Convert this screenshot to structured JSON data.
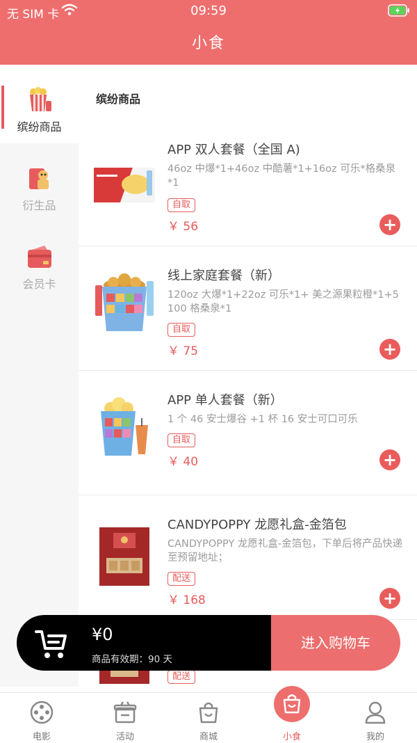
{
  "status_bar": {
    "carrier": "无 SIM 卡",
    "time": "09:59"
  },
  "header": {
    "title": "小食"
  },
  "sidebar": {
    "items": [
      {
        "label": "缤纷商品",
        "icon": "popcorn-icon",
        "active": true
      },
      {
        "label": "衍生品",
        "icon": "merch-icon",
        "active": false
      },
      {
        "label": "会员卡",
        "icon": "card-icon",
        "active": false
      }
    ]
  },
  "main": {
    "section_title": "缤纷商品",
    "products": [
      {
        "name": "APP 双人套餐（全国 A)",
        "desc": "46oz 中爆*1+46oz 中酷薯*1+16oz 可乐*格桑泉*1",
        "badge": "自取",
        "price": "￥ 56"
      },
      {
        "name": "线上家庭套餐（新）",
        "desc": "120oz 大爆*1+22oz 可乐*1+ 美之源果粒橙*1+5 100 格桑泉*1",
        "badge": "自取",
        "price": "￥ 75"
      },
      {
        "name": "APP 单人套餐（新）",
        "desc": "1 个 46 安士爆谷 +1 杯 16 安士可口可乐",
        "badge": "自取",
        "price": "￥ 40"
      },
      {
        "name": "CANDYPOPPY 龙愿礼盒-金箔包",
        "desc": "CANDYPOPPY 龙愿礼盒-金箔包，下单后将产品快递至预留地址；",
        "badge": "配送",
        "price": "￥ 168"
      },
      {
        "badge": "配送"
      }
    ]
  },
  "cart": {
    "total": "¥0",
    "validity": "商品有效期：90 天",
    "checkout_label": "进入购物车"
  },
  "tabbar": {
    "tabs": [
      {
        "label": "电影",
        "icon": "film-reel-icon"
      },
      {
        "label": "活动",
        "icon": "gift-icon"
      },
      {
        "label": "商城",
        "icon": "shopping-bag-icon"
      },
      {
        "label": "小食",
        "icon": "snack-bag-icon",
        "active": true
      },
      {
        "label": "我的",
        "icon": "user-icon"
      }
    ]
  },
  "colors": {
    "brand": "#ee6e6e",
    "accent": "#e55b5b",
    "cart_bar": "#000000"
  }
}
